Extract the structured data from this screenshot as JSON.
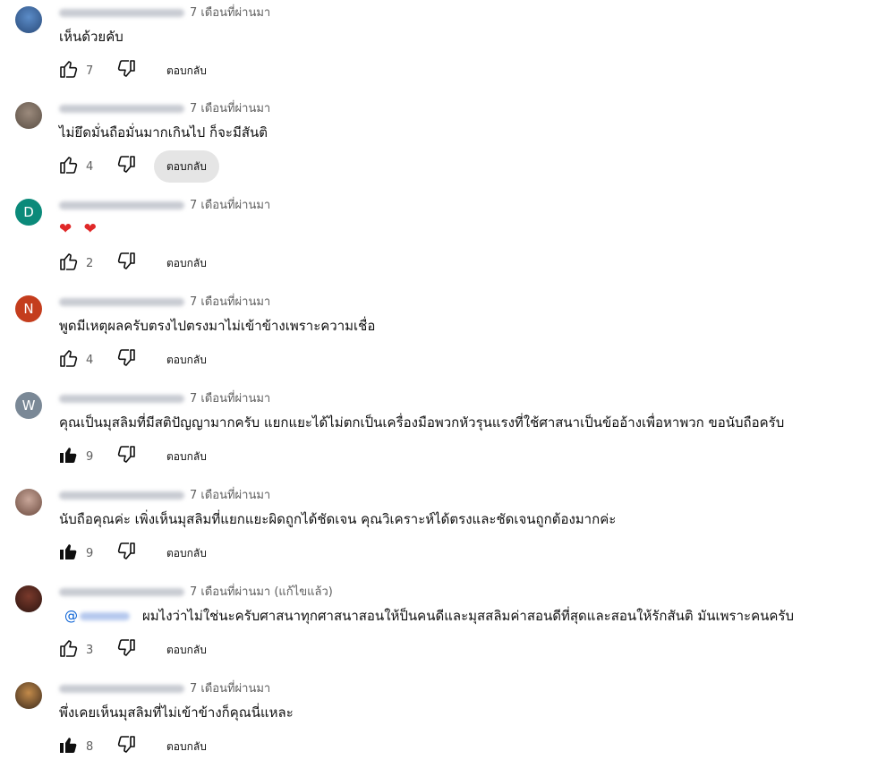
{
  "reply_label": "ตอบกลับ",
  "colors": {
    "link": "#065fd4",
    "muted": "#606060",
    "reply_hover_bg": "#e5e5e5"
  },
  "comments": [
    {
      "avatar": {
        "type": "photo",
        "colors": [
          "#5b8cc8",
          "#2a4b7a"
        ]
      },
      "time": "7 เดือนที่ผ่านมา",
      "text": "เห็นด้วยคับ",
      "likes": "7",
      "liked": false
    },
    {
      "avatar": {
        "type": "photo",
        "colors": [
          "#9b8a7c",
          "#5a4e44"
        ]
      },
      "time": "7 เดือนที่ผ่านมา",
      "text": "ไม่ยึดมั่นถือมั่นมากเกินไป ก็จะมีสันติ",
      "likes": "4",
      "liked": false
    },
    {
      "avatar": {
        "type": "letter",
        "letter": "D",
        "color": "#0b8a7a"
      },
      "time": "7 เดือนที่ผ่านมา",
      "text": "❤ ❤",
      "likes": "2",
      "liked": false
    },
    {
      "avatar": {
        "type": "letter",
        "letter": "N",
        "color": "#c43d1d"
      },
      "time": "7 เดือนที่ผ่านมา",
      "text": "พูดมีเหตุผลครับตรงไปตรงมาไม่เข้าข้างเพราะความเชื่อ",
      "likes": "4",
      "liked": false
    },
    {
      "avatar": {
        "type": "letter",
        "letter": "W",
        "color": "#7a8896"
      },
      "time": "7 เดือนที่ผ่านมา",
      "text": "คุณเป็นมุสลิมที่มีสติปัญญามากครับ แยกแยะได้ไม่ตกเป็นเครื่องมือพวกหัวรุนแรงที่ใช้ศาสนาเป็นข้ออ้างเพื่อหาพวก ขอนับถือครับ",
      "likes": "9",
      "liked": true
    },
    {
      "avatar": {
        "type": "photo",
        "colors": [
          "#c9a79a",
          "#6b4a3e"
        ]
      },
      "time": "7 เดือนที่ผ่านมา",
      "text": "นับถือคุณค่ะ เพิ่งเห็นมุสลิมที่แยกแยะผิดถูกได้ชัดเจน คุณวิเคราะห์ได้ตรงและชัดเจนถูกต้องมากค่ะ",
      "likes": "9",
      "liked": true
    },
    {
      "avatar": {
        "type": "photo",
        "colors": [
          "#7a3a2c",
          "#2d1510"
        ]
      },
      "time": "7 เดือนที่ผ่านมา (แก้ไขแล้ว)",
      "mention": "@",
      "text": "ผมไงว่าไม่ใช่นะครับศาสนาทุกศาสนาสอนให้ป็นคนดีและมุสสลิมค่าสอนดีที่สุดและสอนให้รักสันติ มันเพราะคนครับ",
      "likes": "3",
      "liked": false
    },
    {
      "avatar": {
        "type": "photo",
        "colors": [
          "#c28a4a",
          "#3b2a1c"
        ]
      },
      "time": "7 เดือนที่ผ่านมา",
      "text": "พึ่งเคยเห็นมุสลิมที่ไม่เข้าข้างก็คุณนี่แหละ",
      "likes": "8",
      "liked": true
    }
  ]
}
